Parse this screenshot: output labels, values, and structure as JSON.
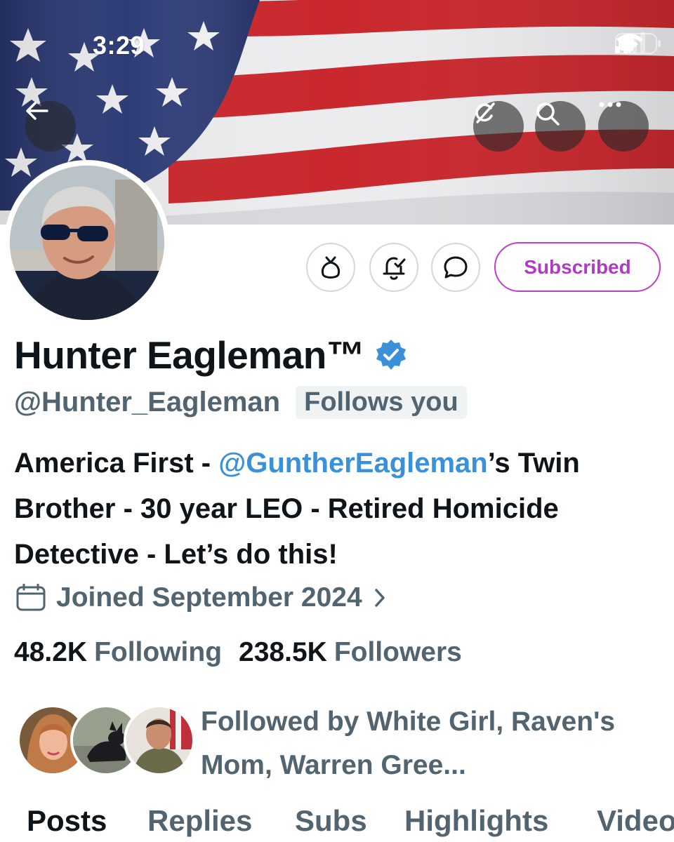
{
  "status_bar": {
    "time": "3:29",
    "icons": [
      "cellular-signal-icon",
      "wifi-icon",
      "battery-icon"
    ]
  },
  "header_buttons": {
    "back_icon": "arrow-left-icon",
    "grok_icon": "grok-icon",
    "search_icon": "search-icon",
    "more_icon": "more-horizontal-icon"
  },
  "banner": {
    "description_icon": "american-flag-banner"
  },
  "actions": {
    "gift_icon": "gift-icon",
    "notifications_icon": "bell-check-icon",
    "message_icon": "message-bubble-icon",
    "subscribed_label": "Subscribed"
  },
  "profile": {
    "display_name": "Hunter Eagleman™",
    "verified_icon": "verified-badge-icon",
    "handle": "@Hunter_Eagleman",
    "follows_you": "Follows you",
    "bio": {
      "part1": "America First - ",
      "mention": "@GuntherEagleman",
      "part2": "’s Twin Brother - 30 year LEO - Retired Homicide Detective - Let’s do this!"
    },
    "joined": "Joined September 2024",
    "joined_icon": "calendar-icon",
    "chevron_icon": "chevron-right-icon",
    "following_count": "48.2K",
    "following_label": "Following",
    "followers_count": "238.5K",
    "followers_label": "Followers",
    "followed_by": "Followed by White Girl, Raven's Mom, Warren Gree..."
  },
  "tabs": [
    {
      "label": "Posts",
      "active": true
    },
    {
      "label": "Replies",
      "active": false
    },
    {
      "label": "Subs",
      "active": false
    },
    {
      "label": "Highlights",
      "active": false
    },
    {
      "label": "Videos",
      "active": false
    }
  ],
  "colors": {
    "accent_blue": "#3b91d8",
    "subscribed_purple": "#b13ac7",
    "secondary_text": "#536471",
    "primary_text": "#0f1419"
  }
}
